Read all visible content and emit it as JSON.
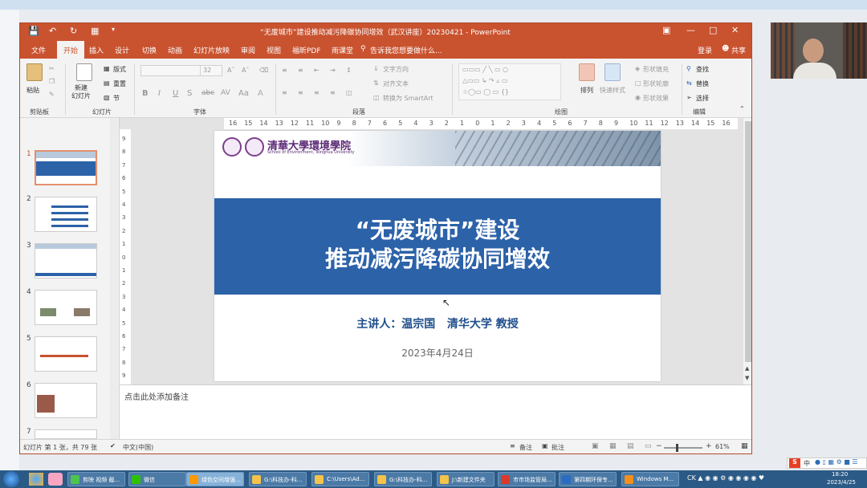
{
  "window": {
    "title": "“无废城市”建设推动减污降碳协同增效（武汉讲座）20230421 - PowerPoint",
    "login": "登录",
    "share": "共享"
  },
  "tabs": [
    "文件",
    "开始",
    "插入",
    "设计",
    "切换",
    "动画",
    "幻灯片放映",
    "审阅",
    "视图",
    "福昕PDF",
    "雨课堂"
  ],
  "tell_me": "告诉我您想要做什么...",
  "ribbon": {
    "paste": "粘贴",
    "new_slide": "新建\n幻灯片",
    "layout": "版式",
    "reset": "重置",
    "section": "节",
    "font_size": "32",
    "text_direction": "文字方向",
    "align_text": "对齐文本",
    "smartart": "转换为 SmartArt",
    "arrange": "排列",
    "quick_styles": "快速样式",
    "shape_fill": "形状填充",
    "shape_outline": "形状轮廓",
    "shape_effects": "形状效果",
    "find": "查找",
    "replace": "替换",
    "select": "选择",
    "groups": {
      "clipboard": "剪贴板",
      "slides": "幻灯片",
      "font": "字体",
      "paragraph": "段落",
      "drawing": "绘图",
      "editing": "编辑"
    }
  },
  "ruler_ticks": [
    "16",
    "15",
    "14",
    "13",
    "12",
    "11",
    "10",
    "9",
    "8",
    "7",
    "6",
    "5",
    "4",
    "3",
    "2",
    "1",
    "0",
    "1",
    "2",
    "3",
    "4",
    "5",
    "6",
    "7",
    "8",
    "9",
    "10",
    "11",
    "12",
    "13",
    "14",
    "15",
    "16"
  ],
  "vruler_ticks": [
    "9",
    "8",
    "7",
    "6",
    "5",
    "4",
    "3",
    "2",
    "1",
    "0",
    "1",
    "2",
    "3",
    "4",
    "5",
    "6",
    "7",
    "8",
    "9"
  ],
  "thumbnails": [
    "1",
    "2",
    "3",
    "4",
    "5",
    "6",
    "7"
  ],
  "slide": {
    "logo_cn": "清華大學環境學院",
    "logo_en": "School of Environment, Tsinghua University",
    "title_line1": "“无废城市”建设",
    "title_line2": "推动减污降碳协同增效",
    "speaker": "主讲人：温宗国   清华大学 教授",
    "date": "2023年4月24日",
    "colors": {
      "band": "#2c62a8",
      "speaker": "#1f4e8c"
    }
  },
  "notes_placeholder": "点击此处添加备注",
  "status": {
    "slide_count": "幻灯片 第 1 张，共 79 张",
    "language": "中文(中国)",
    "notes": "备注",
    "comments": "批注",
    "zoom": "61%",
    "zoom_level": 0.61
  },
  "taskbar": {
    "items": [
      "剪映 视频 截...",
      "微信",
      "绿色空间增强...",
      "G:\\科技办-科...",
      "C:\\Users\\Ad...",
      "G:\\科技办-科...",
      "J:\\新建文件夹",
      "市市场监管局...",
      "第四期环保专...",
      "Windows M..."
    ],
    "time": "18:20",
    "date": "2023/4/25",
    "ime": "中"
  }
}
